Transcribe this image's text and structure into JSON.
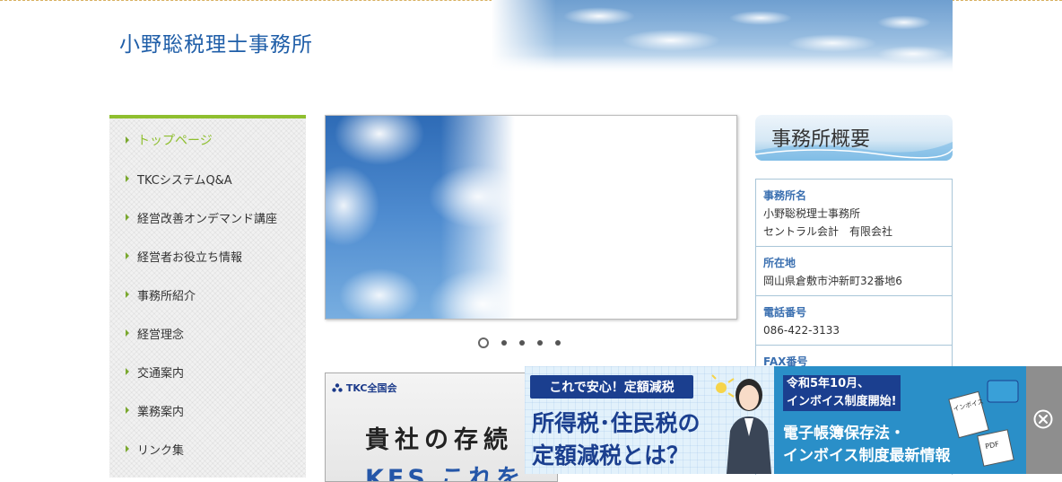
{
  "header": {
    "site_title": "小野聡税理士事務所"
  },
  "sidebar": {
    "items": [
      {
        "label": "トップページ",
        "active": true
      },
      {
        "label": "TKCシステムQ&A"
      },
      {
        "label": "経営改善オンデマンド講座"
      },
      {
        "label": "経営者お役立ち情報"
      },
      {
        "label": "事務所紹介"
      },
      {
        "label": "経営理念"
      },
      {
        "label": "交通案内"
      },
      {
        "label": "業務案内"
      },
      {
        "label": "リンク集"
      }
    ]
  },
  "slider": {
    "active_index": 0,
    "count": 5
  },
  "banner": {
    "logo": "TKC全国会",
    "headline": "貴社の存続",
    "subline": "KFS これを"
  },
  "overview": {
    "heading": "事務所概要",
    "sections": [
      {
        "title": "事務所名",
        "lines": [
          "小野聡税理士事務所",
          "セントラル会計　有限会社"
        ]
      },
      {
        "title": "所在地",
        "lines": [
          "岡山県倉敷市沖新町32番地6"
        ]
      },
      {
        "title": "電話番号",
        "lines": [
          "086-422-3133"
        ]
      },
      {
        "title": "FAX番号",
        "lines": []
      }
    ]
  },
  "ad": {
    "badge": "これで安心！定額減税",
    "headline_1": "所得税･住民税の",
    "headline_2": "定額減税とは？",
    "note_1": "令和5年10月、",
    "note_2": "インボイス制度開始!",
    "right_1": "電子帳簿保存法・",
    "right_2": "インボイス制度最新情報",
    "doc_label_1": "インボイス",
    "doc_label_2": "PDF",
    "close_icon": "close-circle-icon"
  }
}
